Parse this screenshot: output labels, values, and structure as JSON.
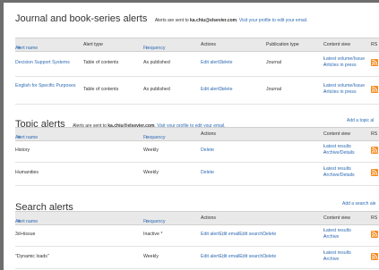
{
  "journal": {
    "title": "Journal and book-series alerts",
    "note_prefix": "Alerts are sent to",
    "email": "ka.chiu@elsevier.com",
    "note_suffix": "Visit your profile to edit your email.",
    "columns": {
      "name": "Alert name",
      "type": "Alert type",
      "frequency": "Frequency",
      "actions": "Actions",
      "pubtype": "Publication type",
      "content": "Content view",
      "rss": "RS"
    },
    "rows": [
      {
        "name": "Decision Support Systems",
        "type": "Table of contents",
        "frequency": "As published",
        "edit": "Edit alert",
        "delete": "Delete",
        "pubtype": "Journal",
        "cv1": "Latest volume/Issue",
        "cv2": "Articles in press"
      },
      {
        "name": "English for Specific Purposes",
        "type": "Table of contents",
        "frequency": "As published",
        "edit": "Edit alert",
        "delete": "Delete",
        "pubtype": "Journal",
        "cv1": "Latest volume/Issue",
        "cv2": "Articles in press"
      }
    ]
  },
  "topic": {
    "title": "Topic alerts",
    "note_prefix": "Alerts are sent to",
    "email": "ka.chiu@elsevier.com",
    "note_suffix": "Visit your profile to edit your email.",
    "add_link": "Add a topic al",
    "columns": {
      "name": "Alert name",
      "frequency": "Frequency",
      "actions": "Actions",
      "content": "Content view",
      "rss": "RS"
    },
    "rows": [
      {
        "name": "History",
        "frequency": "Weekly",
        "delete": "Delete",
        "cv1": "Latest results",
        "cv2": "Archive/Details"
      },
      {
        "name": "Humanities",
        "frequency": "Weekly",
        "delete": "Delete",
        "cv1": "Latest results",
        "cv2": "Archive/Details"
      }
    ]
  },
  "search": {
    "title": "Search alerts",
    "add_link": "Add a search ale",
    "columns": {
      "name": "Alert name",
      "frequency": "Frequency",
      "actions": "Actions",
      "content": "Content view",
      "rss": "RS"
    },
    "rows": [
      {
        "name": "3d+tissue",
        "frequency": "Inactive *",
        "edit": "Edit alert",
        "email": "Edit email",
        "search": "Edit search",
        "delete": "Delete",
        "cv1": "Latest results",
        "cv2": "Archive"
      },
      {
        "name": "\"Dynamic loads\"",
        "frequency": "Weekly",
        "edit": "Edit alert",
        "email": "Edit email",
        "search": "Edit search",
        "delete": "Delete",
        "cv1": "Latest results",
        "cv2": "Archive"
      }
    ]
  },
  "icons": {
    "sort": "sort-arrow-icon",
    "rss": "rss-icon"
  },
  "colors": {
    "link": "#2e6bb5",
    "header_bg": "#e9e9e9",
    "rss": "#f68b1f"
  }
}
